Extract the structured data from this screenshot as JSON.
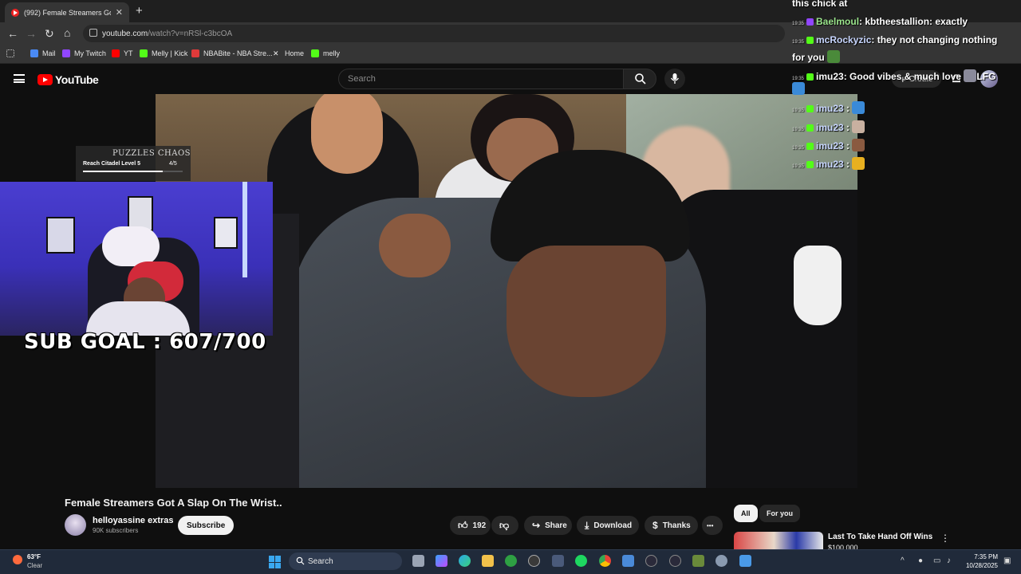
{
  "browser": {
    "tab_title": "(992) Female Streamers Go",
    "tab_close": "✕",
    "new_tab": "+",
    "url_host": "youtube.com",
    "url_path": "/watch?v=nRSl-c3bcOA",
    "nav": {
      "back": "←",
      "forward": "→",
      "reload": "↻",
      "home": "⌂"
    },
    "bookmarks": [
      {
        "label": "Mail",
        "color": "#4a8af4"
      },
      {
        "label": "My Twitch",
        "color": "#9146ff"
      },
      {
        "label": "YT",
        "color": "#ff0000"
      },
      {
        "label": "Melly | Kick",
        "color": "#53fc18"
      },
      {
        "label": "NBABite - NBA Stre...",
        "color": "#e03a3a"
      },
      {
        "label": "Home",
        "color": "#e8e8e8"
      },
      {
        "label": "melly",
        "color": "#53fc18"
      }
    ]
  },
  "youtube": {
    "logo_text": "YouTube",
    "search_placeholder": "Search",
    "create_label": "Create",
    "video_title": "Female Streamers Got A Slap On The Wrist..",
    "channel_name": "helloyassine extras",
    "channel_subs": "90K subscribers",
    "subscribe_label": "Subscribe",
    "like_count": "192",
    "share_label": "Share",
    "download_label": "Download",
    "thanks_label": "Thanks",
    "more_label": "•••",
    "chips": [
      {
        "label": "All"
      },
      {
        "label": "For you"
      }
    ],
    "recommendation": {
      "title": "Last To Take Hand Off Wins",
      "subtitle": "$100,000"
    }
  },
  "stream_overlay": {
    "puzzles_logo": "PUZZLES CHAOS",
    "quest_title": "Reach Citadel Level 5",
    "quest_progress": "4/5",
    "quest_fraction": 0.8,
    "sub_goal": "SUB GOAL : 607/700"
  },
  "chat": {
    "header_line": "this chick at",
    "messages": [
      {
        "time": "19:35",
        "user": "Baelmoul",
        "platform": "twitch",
        "text": ": kbtheestallion: exactly"
      },
      {
        "time": "19:35",
        "user": "mcRockyzic",
        "platform": "kick",
        "text": ": they not changing nothing"
      },
      {
        "time": "",
        "user": "",
        "platform": "",
        "text": "for you"
      },
      {
        "time": "19:35",
        "user": "imu23",
        "platform": "kick",
        "text": ": Good vibes & much love",
        "suffix": "LFG"
      },
      {
        "time": "19:35",
        "user": "imu23",
        "platform": "kick",
        "text": ":"
      },
      {
        "time": "19:35",
        "user": "imu23",
        "platform": "kick",
        "text": ":"
      },
      {
        "time": "19:35",
        "user": "imu23",
        "platform": "kick",
        "text": ":"
      },
      {
        "time": "19:35",
        "user": "imu23",
        "platform": "kick",
        "text": ":"
      }
    ]
  },
  "taskbar": {
    "weather_temp": "63°F",
    "weather_cond": "Clear",
    "search_label": "Search",
    "time": "7:35 PM",
    "date": "10/28/2025"
  }
}
